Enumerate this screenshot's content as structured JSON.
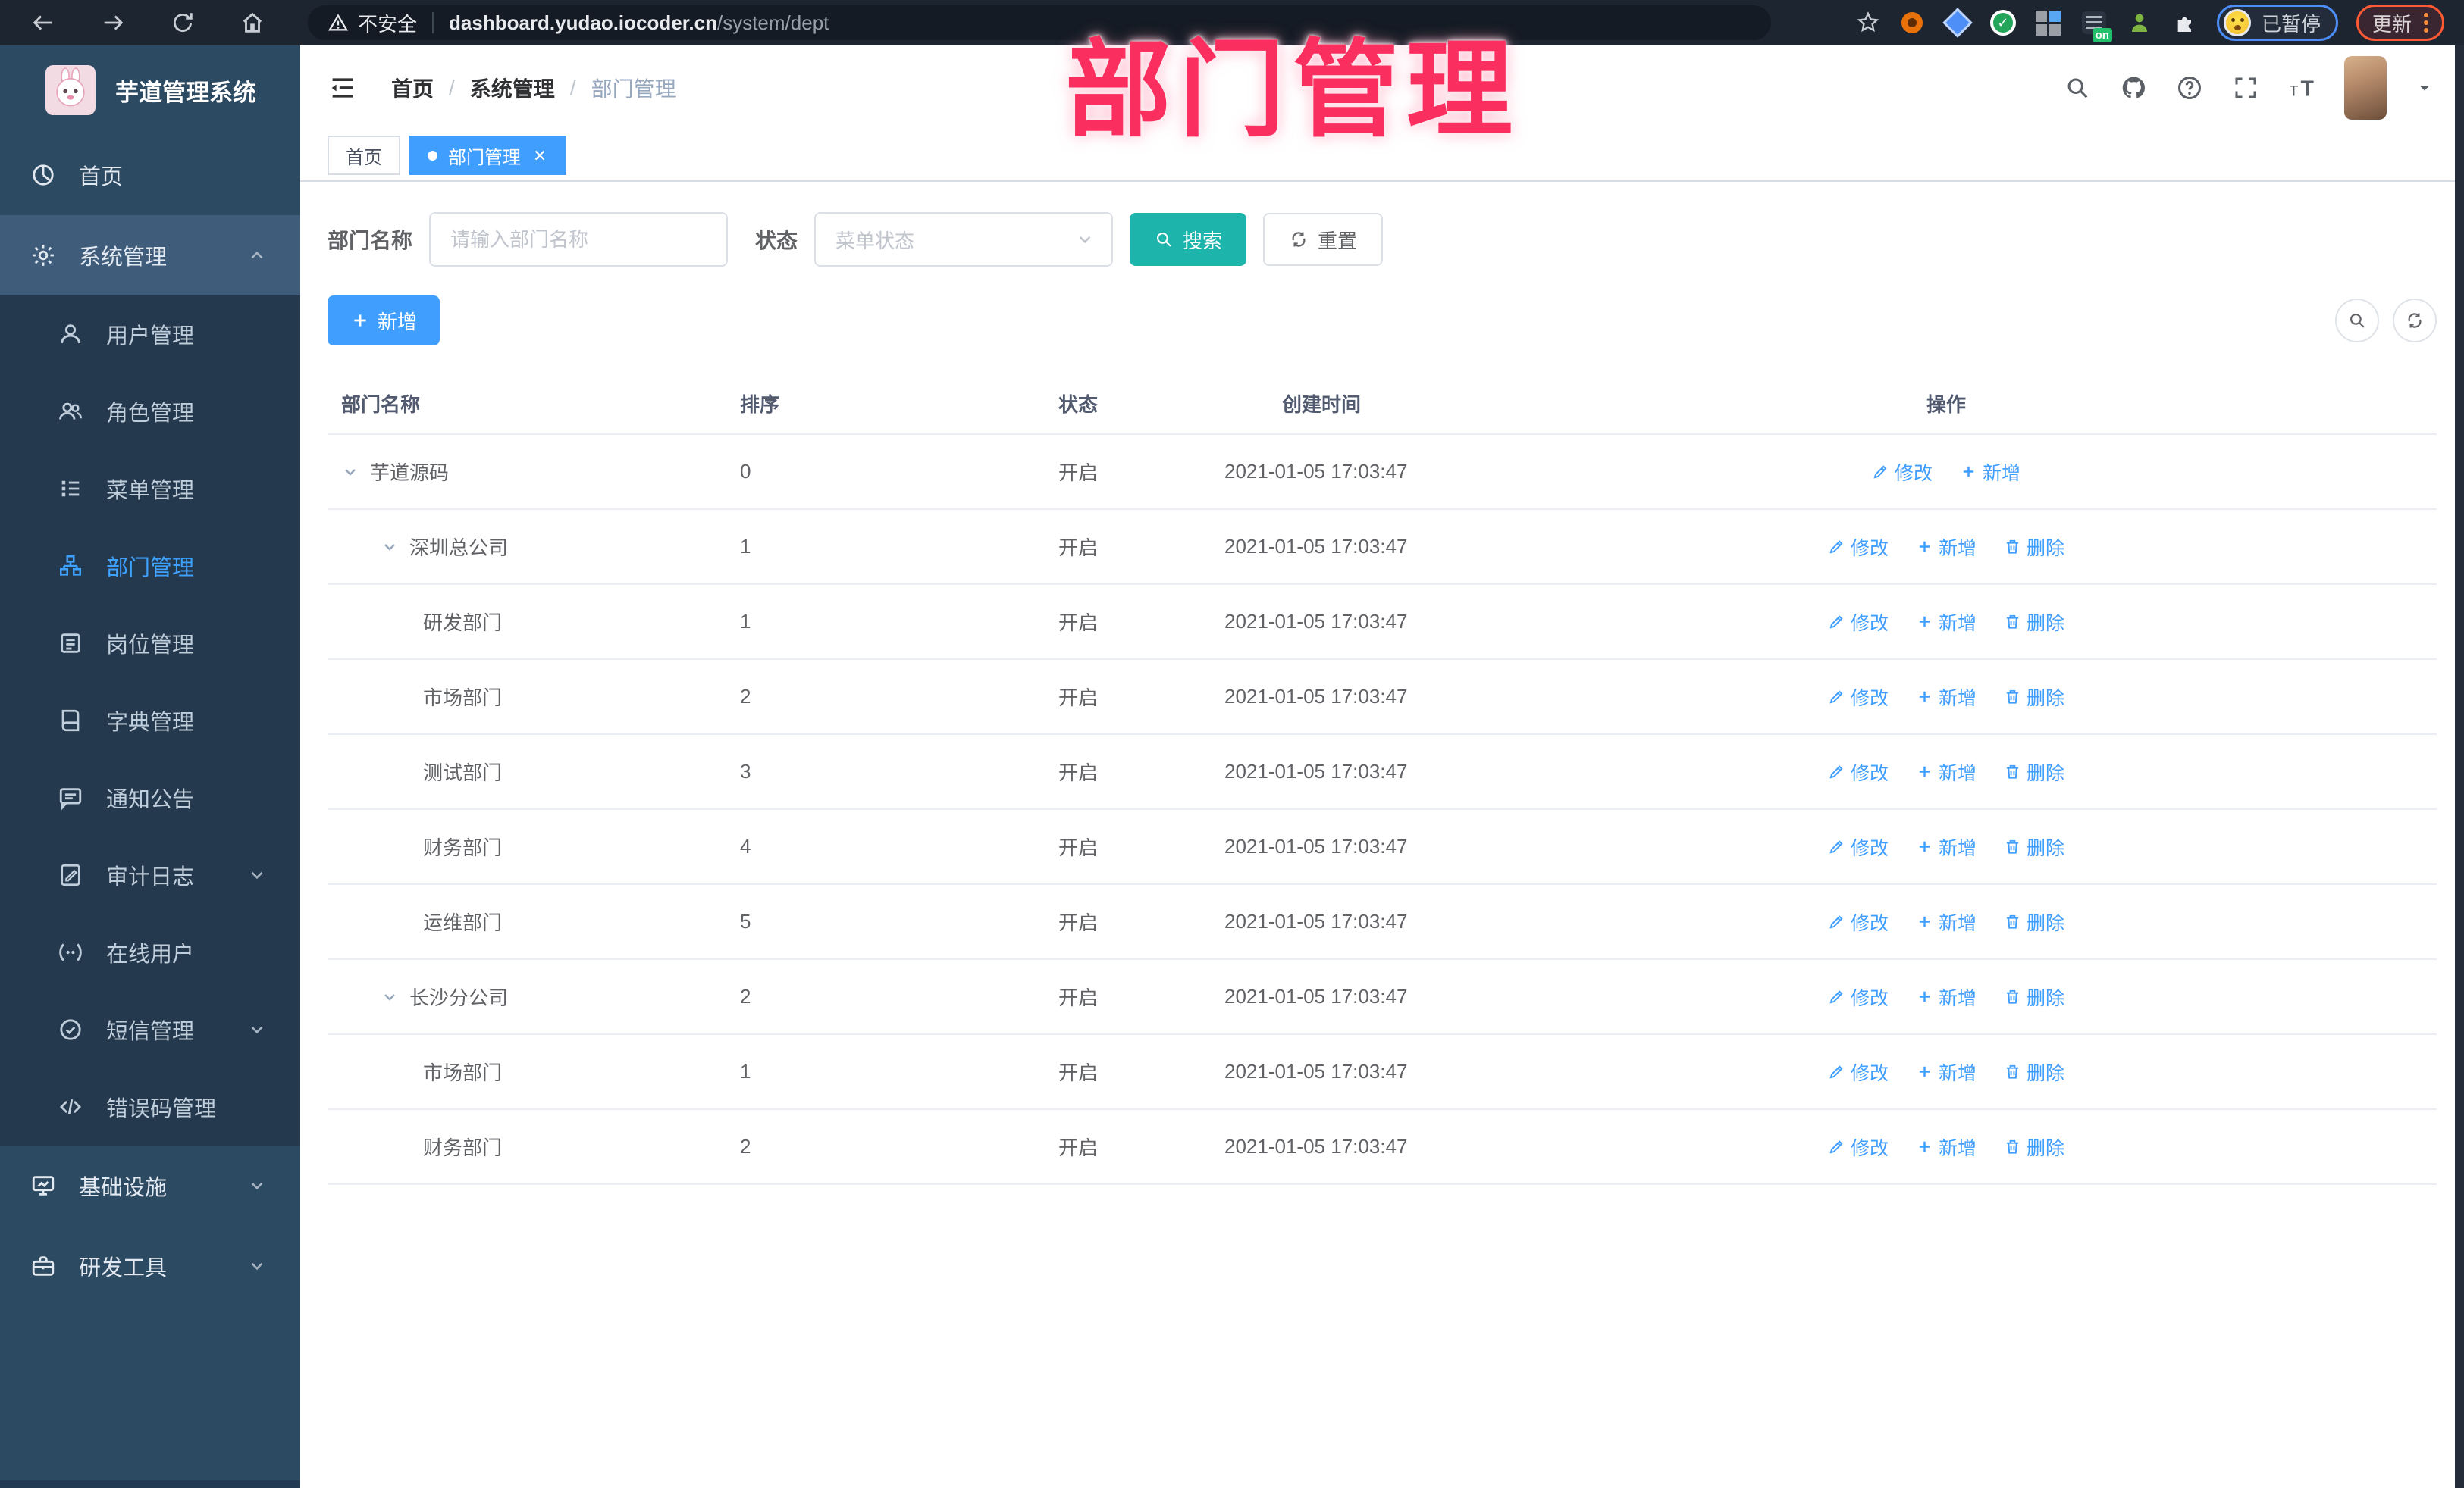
{
  "browser": {
    "security_warning": "不安全",
    "url_host": "dashboard.yudao.iocoder.cn",
    "url_path": "/system/dept",
    "profile_status": "已暂停",
    "update_label": "更新",
    "extension_badge": "on"
  },
  "annotation": {
    "text": "部门管理",
    "color": "#fa2e5f"
  },
  "sidebar": {
    "app_title": "芋道管理系统",
    "items": [
      {
        "key": "home",
        "label": "首页",
        "icon": "dashboard-icon",
        "symbol": "i-dashboard",
        "level": 1
      },
      {
        "key": "system-management",
        "label": "系统管理",
        "icon": "gear-icon",
        "symbol": "i-gear",
        "level": 1,
        "state": "open",
        "chevron": "up"
      },
      {
        "key": "user-management",
        "label": "用户管理",
        "icon": "user-icon",
        "symbol": "i-user",
        "level": 2
      },
      {
        "key": "role-management",
        "label": "角色管理",
        "icon": "users-icon",
        "symbol": "i-users",
        "level": 2
      },
      {
        "key": "menu-management",
        "label": "菜单管理",
        "icon": "menu-tree-icon",
        "symbol": "i-tree",
        "level": 2
      },
      {
        "key": "dept-management",
        "label": "部门管理",
        "icon": "org-tree-icon",
        "symbol": "i-org",
        "level": 2,
        "state": "active"
      },
      {
        "key": "post-management",
        "label": "岗位管理",
        "icon": "badge-icon",
        "symbol": "i-badge",
        "level": 2
      },
      {
        "key": "dict-management",
        "label": "字典管理",
        "icon": "book-icon",
        "symbol": "i-book",
        "level": 2
      },
      {
        "key": "notice",
        "label": "通知公告",
        "icon": "megaphone-icon",
        "symbol": "i-notice",
        "level": 2
      },
      {
        "key": "audit-log",
        "label": "审计日志",
        "icon": "audit-log-icon",
        "symbol": "i-audit",
        "level": 2,
        "chevron": "down"
      },
      {
        "key": "online-users",
        "label": "在线用户",
        "icon": "online-users-icon",
        "symbol": "i-online",
        "level": 2
      },
      {
        "key": "sms-management",
        "label": "短信管理",
        "icon": "sms-icon",
        "symbol": "i-sms",
        "level": 2,
        "chevron": "down"
      },
      {
        "key": "error-code-management",
        "label": "错误码管理",
        "icon": "code-icon",
        "symbol": "i-code",
        "level": 2
      },
      {
        "key": "infrastructure",
        "label": "基础设施",
        "icon": "monitor-icon",
        "symbol": "i-infra",
        "level": 1,
        "chevron": "down"
      },
      {
        "key": "dev-tools",
        "label": "研发工具",
        "icon": "toolbox-icon",
        "symbol": "i-tool",
        "level": 1,
        "chevron": "down"
      }
    ]
  },
  "header": {
    "breadcrumb": [
      "首页",
      "系统管理",
      "部门管理"
    ]
  },
  "tabs": [
    {
      "label": "首页",
      "active": false
    },
    {
      "label": "部门管理",
      "active": true,
      "closable": true
    }
  ],
  "filters": {
    "dept_label": "部门名称",
    "dept_placeholder": "请输入部门名称",
    "status_label": "状态",
    "status_placeholder": "菜单状态",
    "search_label": "搜索",
    "reset_label": "重置"
  },
  "toolbar": {
    "add_label": "新增"
  },
  "table": {
    "columns": [
      "部门名称",
      "排序",
      "状态",
      "创建时间",
      "操作"
    ],
    "action_labels": {
      "edit": "修改",
      "add": "新增",
      "delete": "删除"
    },
    "rows": [
      {
        "name": "芋道源码",
        "level": 1,
        "expandable": true,
        "sort": "0",
        "status": "开启",
        "created": "2021-01-05 17:03:47",
        "actions": [
          "edit",
          "add"
        ]
      },
      {
        "name": "深圳总公司",
        "level": 2,
        "expandable": true,
        "sort": "1",
        "status": "开启",
        "created": "2021-01-05 17:03:47",
        "actions": [
          "edit",
          "add",
          "delete"
        ]
      },
      {
        "name": "研发部门",
        "level": 3,
        "expandable": false,
        "sort": "1",
        "status": "开启",
        "created": "2021-01-05 17:03:47",
        "actions": [
          "edit",
          "add",
          "delete"
        ]
      },
      {
        "name": "市场部门",
        "level": 3,
        "expandable": false,
        "sort": "2",
        "status": "开启",
        "created": "2021-01-05 17:03:47",
        "actions": [
          "edit",
          "add",
          "delete"
        ]
      },
      {
        "name": "测试部门",
        "level": 3,
        "expandable": false,
        "sort": "3",
        "status": "开启",
        "created": "2021-01-05 17:03:47",
        "actions": [
          "edit",
          "add",
          "delete"
        ]
      },
      {
        "name": "财务部门",
        "level": 3,
        "expandable": false,
        "sort": "4",
        "status": "开启",
        "created": "2021-01-05 17:03:47",
        "actions": [
          "edit",
          "add",
          "delete"
        ]
      },
      {
        "name": "运维部门",
        "level": 3,
        "expandable": false,
        "sort": "5",
        "status": "开启",
        "created": "2021-01-05 17:03:47",
        "actions": [
          "edit",
          "add",
          "delete"
        ]
      },
      {
        "name": "长沙分公司",
        "level": 2,
        "expandable": true,
        "sort": "2",
        "status": "开启",
        "created": "2021-01-05 17:03:47",
        "actions": [
          "edit",
          "add",
          "delete"
        ]
      },
      {
        "name": "市场部门",
        "level": 3,
        "expandable": false,
        "sort": "1",
        "status": "开启",
        "created": "2021-01-05 17:03:47",
        "actions": [
          "edit",
          "add",
          "delete"
        ]
      },
      {
        "name": "财务部门",
        "level": 3,
        "expandable": false,
        "sort": "2",
        "status": "开启",
        "created": "2021-01-05 17:03:47",
        "actions": [
          "edit",
          "add",
          "delete"
        ]
      }
    ]
  },
  "colors": {
    "accent": "#409eff",
    "search_button": "#1db5ab",
    "sidebar_bg": "#2d4a63",
    "submenu_bg": "#24394e",
    "tab_active": "#409eff",
    "link": "#409eff",
    "annotation": "#fa2e5f"
  }
}
